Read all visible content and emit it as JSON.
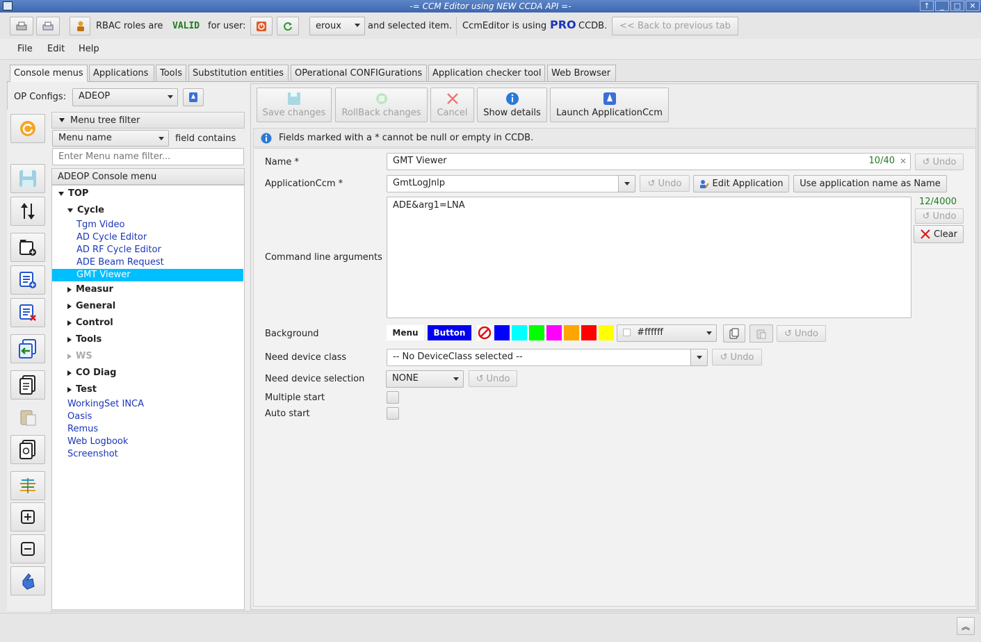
{
  "window": {
    "title": "-= CCM Editor using NEW CCDA API =-",
    "controls": [
      "↑",
      "_",
      "□",
      "✕"
    ]
  },
  "toolbar": {
    "rbac_prefix": "RBAC roles are",
    "rbac_status": "VALID",
    "for_user": "for user:",
    "user": "eroux",
    "and_selected": "and selected item.",
    "ccm_prefix": "CcmEditor is using",
    "ccm_mode": "PRO",
    "ccm_suffix": "CCDB.",
    "back_label": "<< Back to previous tab"
  },
  "menubar": [
    "File",
    "Edit",
    "Help"
  ],
  "tabs": [
    "Console menus",
    "Applications",
    "Tools",
    "Substitution entities",
    "OPerational CONFIGurations",
    "Application checker tool",
    "Web Browser"
  ],
  "left": {
    "op_configs_label": "OP Configs:",
    "op_configs_value": "ADEOP",
    "filter_title": "Menu tree filter",
    "filter_field": "Menu name",
    "filter_mode": "field contains",
    "filter_placeholder": "Enter Menu name filter...",
    "tree_title": "ADEOP Console menu",
    "tree": {
      "top": "TOP",
      "cycle": "Cycle",
      "cycle_items": [
        "Tgm Video",
        "AD Cycle  Editor",
        "AD RF Cycle Editor",
        "ADE Beam Request",
        "GMT Viewer"
      ],
      "groups": [
        "Measur",
        "General",
        "Control",
        "Tools",
        "WS",
        "CO Diag",
        "Test"
      ],
      "root_items": [
        "WorkingSet INCA",
        "Oasis",
        "Remus",
        "Web Logbook",
        "Screenshot"
      ]
    }
  },
  "actions": {
    "save": "Save changes",
    "rollback": "RollBack changes",
    "cancel": "Cancel",
    "details": "Show details",
    "launch": "Launch ApplicationCcm"
  },
  "info": "Fields marked with a * cannot be null or empty in CCDB.",
  "form": {
    "name_label": "Name *",
    "name_value": "GMT Viewer",
    "name_count": "10/40",
    "app_label": "ApplicationCcm *",
    "app_value": "GmtLogJnlp",
    "edit_app": "Edit Application",
    "use_name": "Use application name as Name",
    "cmd_label": "Command line arguments",
    "cmd_value": "ADE&arg1=LNA",
    "cmd_count": "12/4000",
    "clear": "Clear",
    "bg_label": "Background",
    "bg_menu": "Menu",
    "bg_button": "Button",
    "bg_value": "#ffffff",
    "device_class_label": "Need device class",
    "device_class_value": "-- No DeviceClass selected --",
    "device_sel_label": "Need device selection",
    "device_sel_value": "NONE",
    "multi_label": "Multiple start",
    "auto_label": "Auto start",
    "undo": "Undo"
  },
  "colors": {
    "accent_blue": "#1a35b8",
    "selection": "#00bfff",
    "valid_green": "#1f7a1f",
    "swatches": [
      "#0000ff",
      "#00ffff",
      "#00ff00",
      "#ff00ff",
      "#ffa500",
      "#ff0000",
      "#ffff00"
    ]
  }
}
